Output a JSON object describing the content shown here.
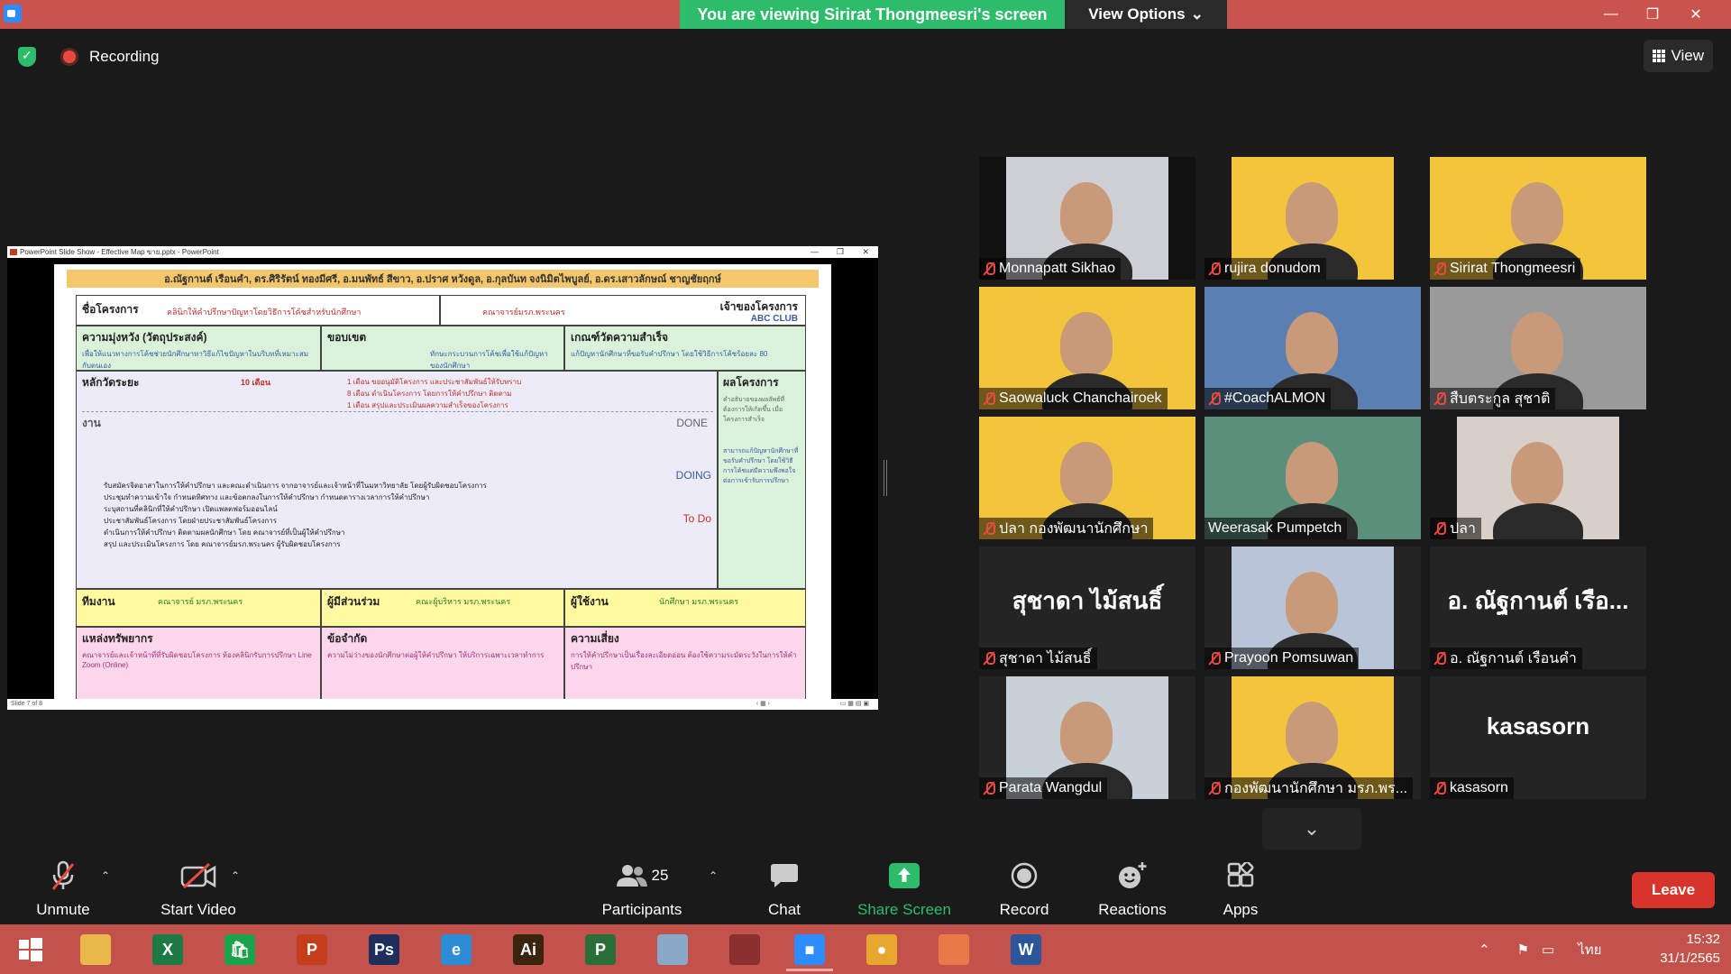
{
  "window": {
    "banner_text": "You are viewing Sirirat Thongmeesri's screen",
    "view_options_label": "View Options",
    "minimize_glyph": "—",
    "maximize_glyph": "❐",
    "close_glyph": "✕"
  },
  "status": {
    "recording_label": "Recording",
    "view_label": "View"
  },
  "slide_window": {
    "title": "PowerPoint Slide Show - Effective Map ขาย.pptx - PowerPoint",
    "footer": "Slide 7 of 8",
    "names_bar": "อ.ณัฐกานต์ เรือนคำ, ดร.ศิริรัตน์ ทองมีศรี, อ.มนพัทธ์ สีขาว, อ.ปราศ หวังดูล, อ.กุลบันท จงนิมิตไพบูลย์, อ.ดร.เสาวลักษณ์ ชาญชัยฤกษ์",
    "project_name_label": "ชื่อโครงการ",
    "project_name_value": "คลินิกให้คำปรึกษาปัญหาโดยวิธีการโค้ชสำหรับนักศึกษา",
    "owner_value": "คณาจารย์มรภ.พระนคร",
    "owner_label": "เจ้าของโครงการ",
    "owner_logo": "ABC CLUB",
    "goal_label": "ความมุ่งหวัง (วัตถุประสงค์)",
    "goal_text": "เพื่อให้แนวทางการโค้ชช่วยนักศึกษาหาวิธีแก้ไขปัญหาในบริบทที่เหมาะสมกับตนเอง",
    "scope_label": "ขอบเขต",
    "scope_text": "ทักษะกระบวนการโค้ชเพื่อใช้แก้ปัญหาของนักศึกษา",
    "criteria_label": "เกณฑ์วัดความสำเร็จ",
    "criteria_text": "แก้ปัญหานักศึกษาที่ขอรับคำปรึกษา โดยใช้วิธีการโค้ชร้อยละ 80",
    "milestone_label": "หลักวัดระยะ",
    "milestone_duration": "10 เดือน",
    "milestone_items": [
      "1 เดือน ขออนุมัติโครงการ และประชาสัมพันธ์ให้รับทราบ",
      "8 เดือน ดำเนินโครงการ โดยการให้คำปรึกษา ติดตาม",
      "1 เดือน สรุปและประเมินผลความสำเร็จของโครงการ"
    ],
    "result_label": "ผลโครงการ",
    "result_text": "คำอธิบายของผลลัพธ์ที่ต้องการให้เกิดขึ้น เมื่อโครงการสำเร็จ",
    "result_text2": "สามารถแก้ปัญหานักศึกษาที่ขอรับคำปรึกษา โดยใช้วิธีการโค้ชแต่มีความพึงพอใจต่อการเข้ารับการปรึกษา",
    "work_label": "งาน",
    "done_label": "DONE",
    "doing_label": "DOING",
    "todo_label": "To Do",
    "tasks": [
      "รับสมัครจิตอาสาในการให้คำปรึกษา และคณะดำเนินการ จากอาจารย์และเจ้าหน้าที่ในมหาวิทยาลัย โดยผู้รับผิดชอบโครงการ",
      "ประชุมทำความเข้าใจ กำหนดทิศทาง และข้อตกลงในการให้คำปรึกษา กำหนดตารางเวลาการให้คำปรึกษา",
      "ระบุสถานที่คลินิกที่ให้คำปรึกษา เปิดแพลตฟอร์มออนไลน์",
      "ประชาสัมพันธ์โครงการ โดยฝ่ายประชาสัมพันธ์โครงการ",
      "ดำเนินการให้คำปรึกษา ติดตามผลนักศึกษา โดย คณาจารย์ที่เป็นผู้ให้คำปรึกษา",
      "สรุป และประเมินโครงการ โดย คณาจารย์มรภ.พระนคร ผู้รับผิดชอบโครงการ"
    ],
    "team_label": "ทีมงาน",
    "team_value": "คณาจารย์ มรภ.พระนคร",
    "stakeholder_label": "ผู้มีส่วนร่วม",
    "stakeholder_value": "คณะผู้บริหาร มรภ.พระนคร",
    "user_label": "ผู้ใช้งาน",
    "user_value": "นักศึกษา มรภ.พระนคร",
    "resource_label": "แหล่งทรัพยากร",
    "resource_text": "คณาจารย์และเจ้าหน้าที่ที่รับผิดชอบโครงการ ห้องคลินิกรับการปรึกษา Line Zoom (Online)",
    "constraint_label": "ข้อจำกัด",
    "constraint_text": "ความไม่ว่างของนักศึกษาต่อผู้ให้คำปรึกษา ให้บริการเฉพาะเวลาทำการ",
    "risk_label": "ความเสี่ยง",
    "risk_text": "การให้คำปรึกษาเป็นเรื่องละเอียดอ่อน ต้องใช้ความระมัดระวังในการให้คำปรึกษา"
  },
  "participants_grid": [
    {
      "name": "Monnapatt Sikhao",
      "muted": true,
      "bg": "#111111",
      "vid": "#cfcfd6"
    },
    {
      "name": "rujira donudom",
      "muted": true,
      "bg": "#1a1a1a",
      "vid": "#f3c53b"
    },
    {
      "name": "Sirirat Thongmeesri",
      "muted": true,
      "bg": "#f3c53b",
      "vid": "#f3c53b"
    },
    {
      "name": "Saowaluck Chanchairoek",
      "muted": true,
      "bg": "#f3c53b",
      "vid": "#f3c53b"
    },
    {
      "name": "#CoachALMON",
      "muted": true,
      "bg": "#5a7fb0",
      "vid": "#5a7fb0"
    },
    {
      "name": "สืบตระกูล สุชาติ",
      "muted": true,
      "bg": "#9a9a9a",
      "vid": "#9a9a9a"
    },
    {
      "name": "ปลา กองพัฒนานักศึกษา",
      "muted": true,
      "bg": "#f3c53b",
      "vid": "#f3c53b"
    },
    {
      "name": "Weerasak Pumpetch",
      "muted": false,
      "bg": "#5a8f7a",
      "vid": "#5a8f7a"
    },
    {
      "name": "ปลา",
      "muted": true,
      "bg": "#1a1a1a",
      "vid": "#d8d0c8"
    },
    {
      "name": "สุชาดา ไม้สนธิ์",
      "muted": true,
      "bg": "#242424",
      "vid": "",
      "big": "สุชาดา ไม้สนธิ์"
    },
    {
      "name": "Prayoon Pomsuwan",
      "muted": true,
      "bg": "#242424",
      "vid": "#b8c4d8"
    },
    {
      "name": "อ. ณัฐกานต์ เรือนคำ",
      "muted": true,
      "bg": "#242424",
      "vid": "",
      "big": "อ. ณัฐกานต์ เรือ..."
    },
    {
      "name": "Parata Wangdul",
      "muted": true,
      "bg": "#242424",
      "vid": "#c8d0d8"
    },
    {
      "name": "กองพัฒนานักศึกษา มรภ.พร...",
      "muted": true,
      "bg": "#242424",
      "vid": "#f3c53b"
    },
    {
      "name": "kasasorn",
      "muted": true,
      "bg": "#242424",
      "vid": "",
      "big": "kasasorn"
    }
  ],
  "toolbar": {
    "unmute_label": "Unmute",
    "start_video_label": "Start Video",
    "participants_label": "Participants",
    "participants_count": "25",
    "chat_label": "Chat",
    "share_label": "Share Screen",
    "record_label": "Record",
    "reactions_label": "Reactions",
    "apps_label": "Apps",
    "leave_label": "Leave"
  },
  "taskbar": {
    "language": "ไทย",
    "time": "15:32",
    "date": "31/1/2565",
    "apps": [
      {
        "name": "start",
        "color": "#ffffff",
        "glyph": ""
      },
      {
        "name": "file-explorer",
        "color": "#e8b84a",
        "glyph": ""
      },
      {
        "name": "excel",
        "color": "#1d7a44",
        "glyph": "X"
      },
      {
        "name": "store",
        "color": "#1aa34a",
        "glyph": "🛍"
      },
      {
        "name": "powerpoint",
        "color": "#c43e1c",
        "glyph": "P"
      },
      {
        "name": "photoshop",
        "color": "#1d2f5a",
        "glyph": "Ps"
      },
      {
        "name": "internet-explorer",
        "color": "#2d8cd6",
        "glyph": "e"
      },
      {
        "name": "illustrator",
        "color": "#3a2410",
        "glyph": "Ai"
      },
      {
        "name": "project",
        "color": "#2a6e3a",
        "glyph": "P"
      },
      {
        "name": "pen-tool",
        "color": "#8aa8c8",
        "glyph": ""
      },
      {
        "name": "photoscape",
        "color": "#8a3030",
        "glyph": ""
      },
      {
        "name": "zoom",
        "color": "#2d8cff",
        "glyph": "■"
      },
      {
        "name": "chrome",
        "color": "#e8a830",
        "glyph": "●"
      },
      {
        "name": "photos",
        "color": "#e87a4a",
        "glyph": ""
      },
      {
        "name": "word",
        "color": "#2b579a",
        "glyph": "W"
      }
    ]
  }
}
